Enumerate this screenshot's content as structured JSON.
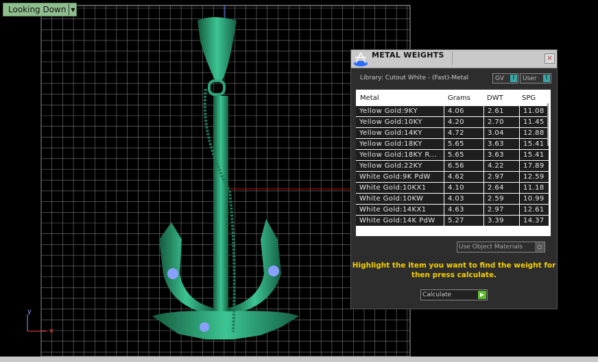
{
  "viewport": {
    "view_name": "Looking Down",
    "axis_y": "y",
    "axis_x": "x"
  },
  "panel": {
    "title": "METAL WEIGHTS",
    "close": "×",
    "library": "Library: Cutout White - (Fast)-Metal",
    "toggle_gv": "GV",
    "toggle_user": "User",
    "columns": [
      "Metal",
      "Grams",
      "DWT",
      "SPG"
    ],
    "rows": [
      [
        "Yellow Gold:9KY",
        "4.06",
        "2.61",
        "11.08"
      ],
      [
        "Yellow Gold:10KY",
        "4.20",
        "2.70",
        "11.45"
      ],
      [
        "Yellow Gold:14KY",
        "4.72",
        "3.04",
        "12.88"
      ],
      [
        "Yellow Gold:18KY",
        "5.65",
        "3.63",
        "15.41"
      ],
      [
        "Yellow Gold:18KY R...",
        "5.65",
        "3.63",
        "15.41"
      ],
      [
        "Yellow Gold:22KY",
        "6.56",
        "4.22",
        "17.89"
      ],
      [
        "White Gold:9K PdW",
        "4.62",
        "2.97",
        "12.59"
      ],
      [
        "White Gold:10KX1",
        "4.10",
        "2.64",
        "11.18"
      ],
      [
        "White Gold:10KW",
        "4.03",
        "2.59",
        "10.99"
      ],
      [
        "White Gold:14KX1",
        "4.63",
        "2.97",
        "12.61"
      ],
      [
        "White Gold:14K PdW",
        "5.27",
        "3.39",
        "14.37"
      ]
    ],
    "use_object_materials": "Use Object Materials",
    "message": "Highlight the item you want to find the weight for then press calculate.",
    "calculate": "Calculate"
  },
  "colors": {
    "model": "#2fa57a",
    "accent": "#f5d000",
    "grid": "#7a7a7a"
  }
}
